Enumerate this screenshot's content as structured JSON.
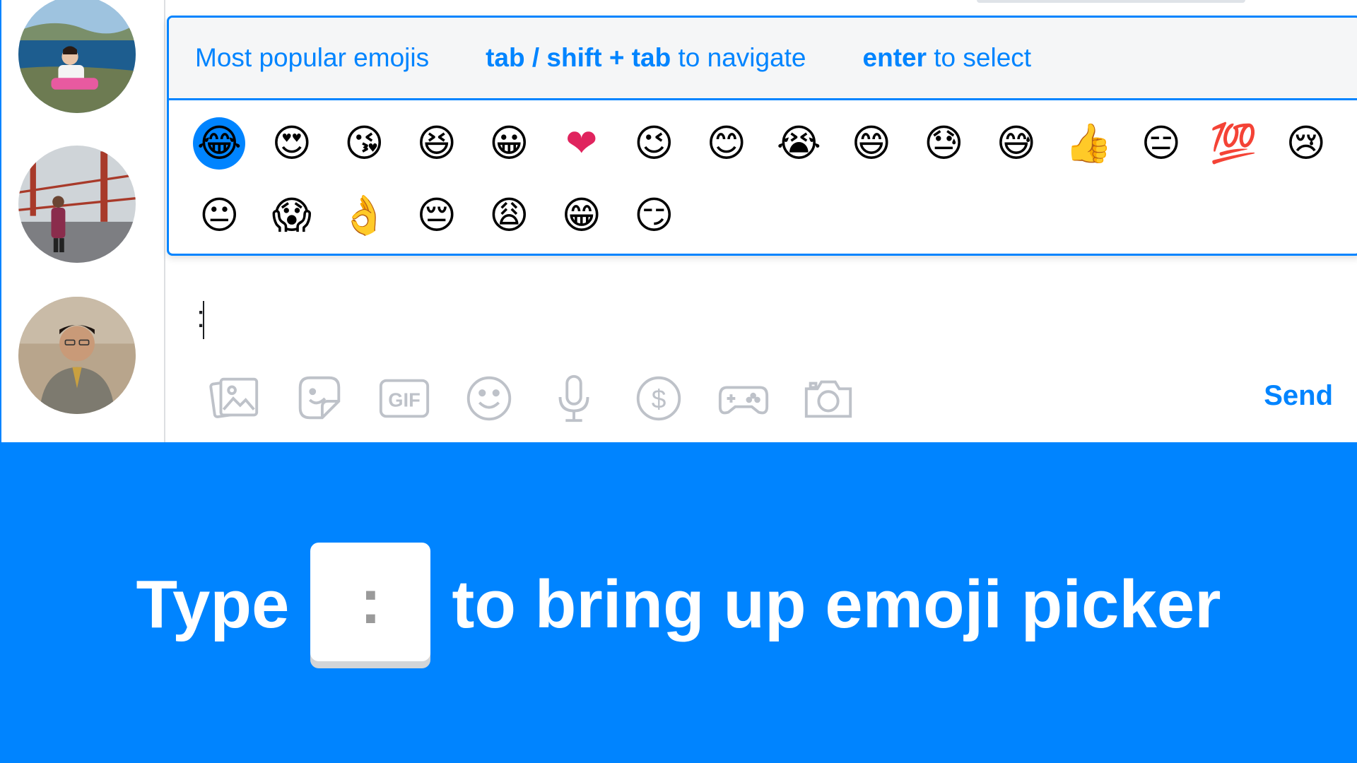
{
  "picker": {
    "title": "Most popular emojis",
    "nav_key": "tab / shift + tab",
    "nav_text": " to navigate",
    "select_key": "enter",
    "select_text": " to select",
    "emojis": [
      {
        "name": "joy",
        "char": "😂"
      },
      {
        "name": "heart-eyes",
        "char": "😍"
      },
      {
        "name": "kissing-heart",
        "char": "😘"
      },
      {
        "name": "laughing",
        "char": "😆"
      },
      {
        "name": "grinning",
        "char": "😀"
      },
      {
        "name": "red-heart",
        "char": "❤"
      },
      {
        "name": "wink",
        "char": "😉"
      },
      {
        "name": "blush",
        "char": "😊"
      },
      {
        "name": "sob",
        "char": "😭"
      },
      {
        "name": "smile",
        "char": "😄"
      },
      {
        "name": "sweat",
        "char": "😓"
      },
      {
        "name": "sweat-smile",
        "char": "😅"
      },
      {
        "name": "thumbs-up",
        "char": "👍"
      },
      {
        "name": "expressionless",
        "char": "😑"
      },
      {
        "name": "hundred",
        "char": "💯"
      },
      {
        "name": "cry",
        "char": "😢"
      },
      {
        "name": "neutral",
        "char": "😐"
      },
      {
        "name": "scream",
        "char": "😱"
      },
      {
        "name": "ok-hand",
        "char": "👌"
      },
      {
        "name": "pensive",
        "char": "😔"
      },
      {
        "name": "weary",
        "char": "😩"
      },
      {
        "name": "grin",
        "char": "😁"
      },
      {
        "name": "smirk",
        "char": "😏"
      }
    ],
    "selected_index": 0
  },
  "composer": {
    "typed_text": ":",
    "send_label": "Send",
    "tools": [
      "photos-icon",
      "sticker-icon",
      "gif-icon",
      "emoji-icon",
      "microphone-icon",
      "payment-icon",
      "game-icon",
      "camera-icon"
    ],
    "gif_label": "GIF",
    "payment_symbol": "$"
  },
  "banner": {
    "before": "Type",
    "key": ":",
    "after": "to bring up emoji picker"
  },
  "colors": {
    "accent": "#0084ff",
    "icon_gray": "#bec2c9",
    "header_bg": "#f5f6f7"
  }
}
